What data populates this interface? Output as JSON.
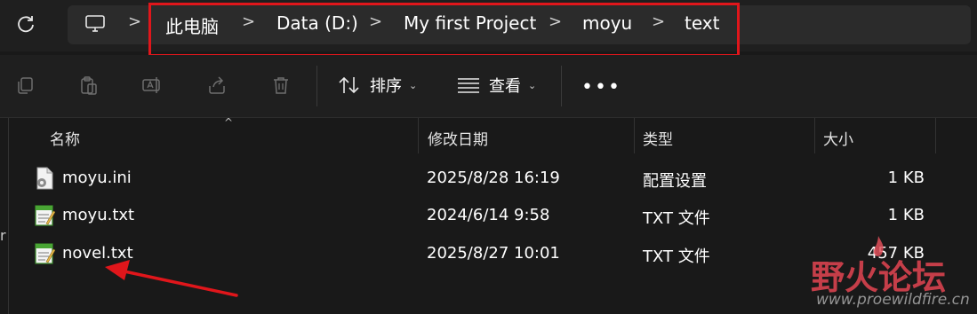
{
  "breadcrumb": {
    "items": [
      "此电脑",
      "Data (D:)",
      "My first Project",
      "moyu",
      "text"
    ],
    "separator": ">"
  },
  "toolbar": {
    "sort_label": "排序",
    "view_label": "查看",
    "more_label": "•••",
    "chevron": "⌄"
  },
  "columns": {
    "name": "名称",
    "date": "修改日期",
    "type": "类型",
    "size": "大小",
    "sort_indicator": "^"
  },
  "files": [
    {
      "name": "moyu.ini",
      "date": "2025/8/28 16:19",
      "type": "配置设置",
      "size": "1 KB",
      "icon": "settings-file-icon"
    },
    {
      "name": "moyu.txt",
      "date": "2024/6/14 9:58",
      "type": "TXT 文件",
      "size": "1 KB",
      "icon": "notepad-file-icon"
    },
    {
      "name": "novel.txt",
      "date": "2025/8/27 10:01",
      "type": "TXT 文件",
      "size": "457 KB",
      "icon": "notepad-file-icon"
    }
  ],
  "watermark": {
    "title": "野火论坛",
    "url": "www.proewildfire.cn"
  },
  "edge_fragment": "r",
  "colors": {
    "highlight_box": "#e0161b",
    "arrow": "#e0161b",
    "background": "#191919",
    "address_bar": "#2b2b2b"
  }
}
